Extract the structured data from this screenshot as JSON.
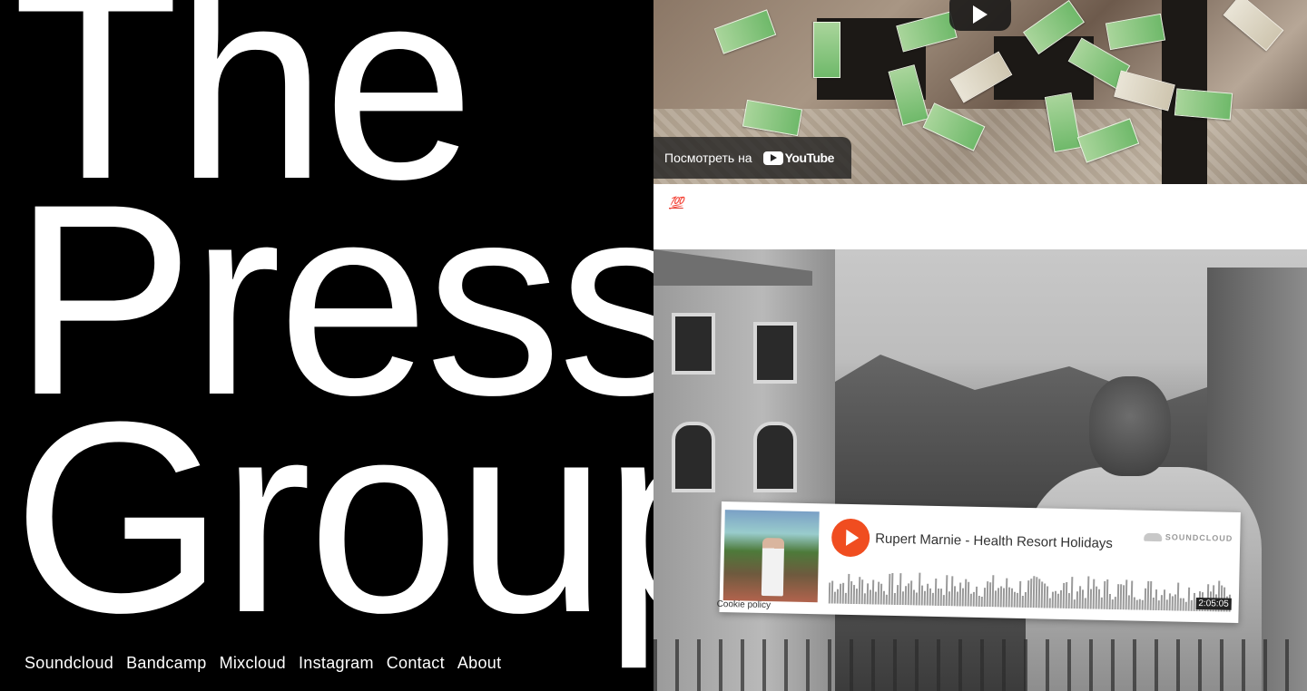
{
  "title": {
    "lines": [
      "The",
      "Press",
      "Group"
    ]
  },
  "nav": {
    "items": [
      {
        "label": "Soundcloud"
      },
      {
        "label": "Bandcamp"
      },
      {
        "label": "Mixcloud"
      },
      {
        "label": "Instagram"
      },
      {
        "label": "Contact"
      },
      {
        "label": "About"
      }
    ]
  },
  "video": {
    "watch_label": "Посмотреть на",
    "provider": "YouTube",
    "play_icon": "play-icon"
  },
  "post": {
    "emoji_text": "💯"
  },
  "soundcloud": {
    "track_title": "Rupert Marnie - Health Resort Holidays",
    "brand": "SOUNDCLOUD",
    "duration": "2:05:05",
    "cookie_policy": "Cookie policy",
    "accent": "#f04d20"
  },
  "colors": {
    "background_left": "#000000",
    "text_left": "#ffffff",
    "background_right": "#ffffff"
  }
}
